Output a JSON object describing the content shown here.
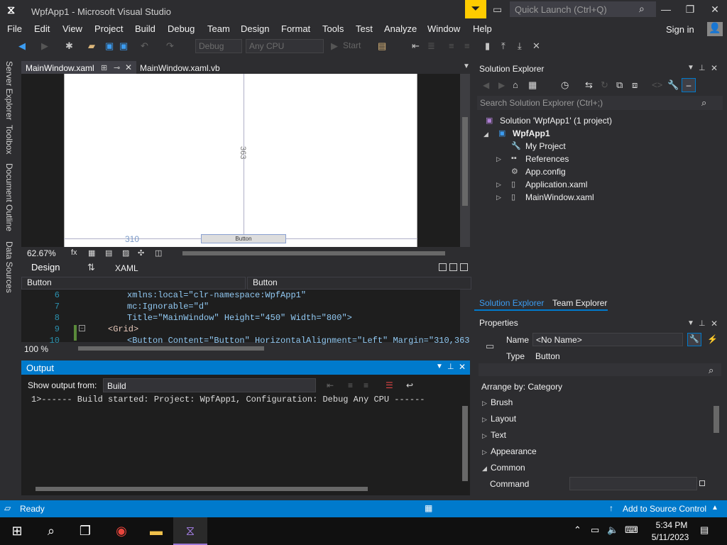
{
  "window": {
    "title": "WpfApp1 - Microsoft Visual Studio",
    "quick_launch_placeholder": "Quick Launch (Ctrl+Q)",
    "sign_in": "Sign in"
  },
  "menu": [
    "File",
    "Edit",
    "View",
    "Project",
    "Build",
    "Debug",
    "Team",
    "Design",
    "Format",
    "Tools",
    "Test",
    "Analyze",
    "Window",
    "Help"
  ],
  "toolbar": {
    "configuration": "Debug",
    "platform": "Any CPU",
    "start_label": "Start"
  },
  "left_tabs": [
    "Server Explorer",
    "Toolbox",
    "Document Outline",
    "Data Sources"
  ],
  "document_tabs": [
    {
      "label": "MainWindow.xaml",
      "active": true
    },
    {
      "label": "MainWindow.xaml.vb",
      "active": false
    }
  ],
  "designer": {
    "dimension_vertical": "363",
    "dimension_horizontal": "310",
    "button_content": "Button",
    "zoom": "62.67%",
    "design_tab": "Design",
    "xaml_tab": "XAML",
    "nav_left": "Button",
    "nav_right": "Button"
  },
  "code": {
    "lines": [
      {
        "num": "6",
        "text": "xmlns:local=\"clr-namespace:WpfApp1\""
      },
      {
        "num": "7",
        "text": "mc:Ignorable=\"d\""
      },
      {
        "num": "8",
        "text": "Title=\"MainWindow\" Height=\"450\" Width=\"800\">"
      },
      {
        "num": "9",
        "text": "<Grid>"
      },
      {
        "num": "10",
        "text": "<Button Content=\"Button\" HorizontalAlignment=\"Left\" Margin=\"310,363"
      }
    ],
    "zoom": "100 %"
  },
  "output": {
    "title": "Output",
    "show_from_label": "Show output from:",
    "source": "Build",
    "text": "1>------ Build started: Project: WpfApp1, Configuration: Debug Any CPU ------"
  },
  "solution_explorer": {
    "title": "Solution Explorer",
    "search_placeholder": "Search Solution Explorer (Ctrl+;)",
    "tree": {
      "solution": "Solution 'WpfApp1' (1 project)",
      "project": "WpfApp1",
      "items": [
        "My Project",
        "References",
        "App.config",
        "Application.xaml",
        "MainWindow.xaml"
      ]
    },
    "tabs": [
      "Solution Explorer",
      "Team Explorer"
    ]
  },
  "properties": {
    "title": "Properties",
    "name_label": "Name",
    "name_value": "<No Name>",
    "type_label": "Type",
    "type_value": "Button",
    "arrange_by": "Arrange by: Category",
    "categories": [
      "Brush",
      "Layout",
      "Text",
      "Appearance",
      "Common"
    ],
    "command_label": "Command"
  },
  "status": {
    "text": "Ready",
    "source_control": "Add to Source Control"
  },
  "taskbar": {
    "time": "5:34 PM",
    "date": "5/11/2023"
  },
  "colors": {
    "accent": "#007acc",
    "background": "#2d2d30",
    "editor": "#1e1e1e",
    "filter_yellow": "#ffcc00"
  }
}
